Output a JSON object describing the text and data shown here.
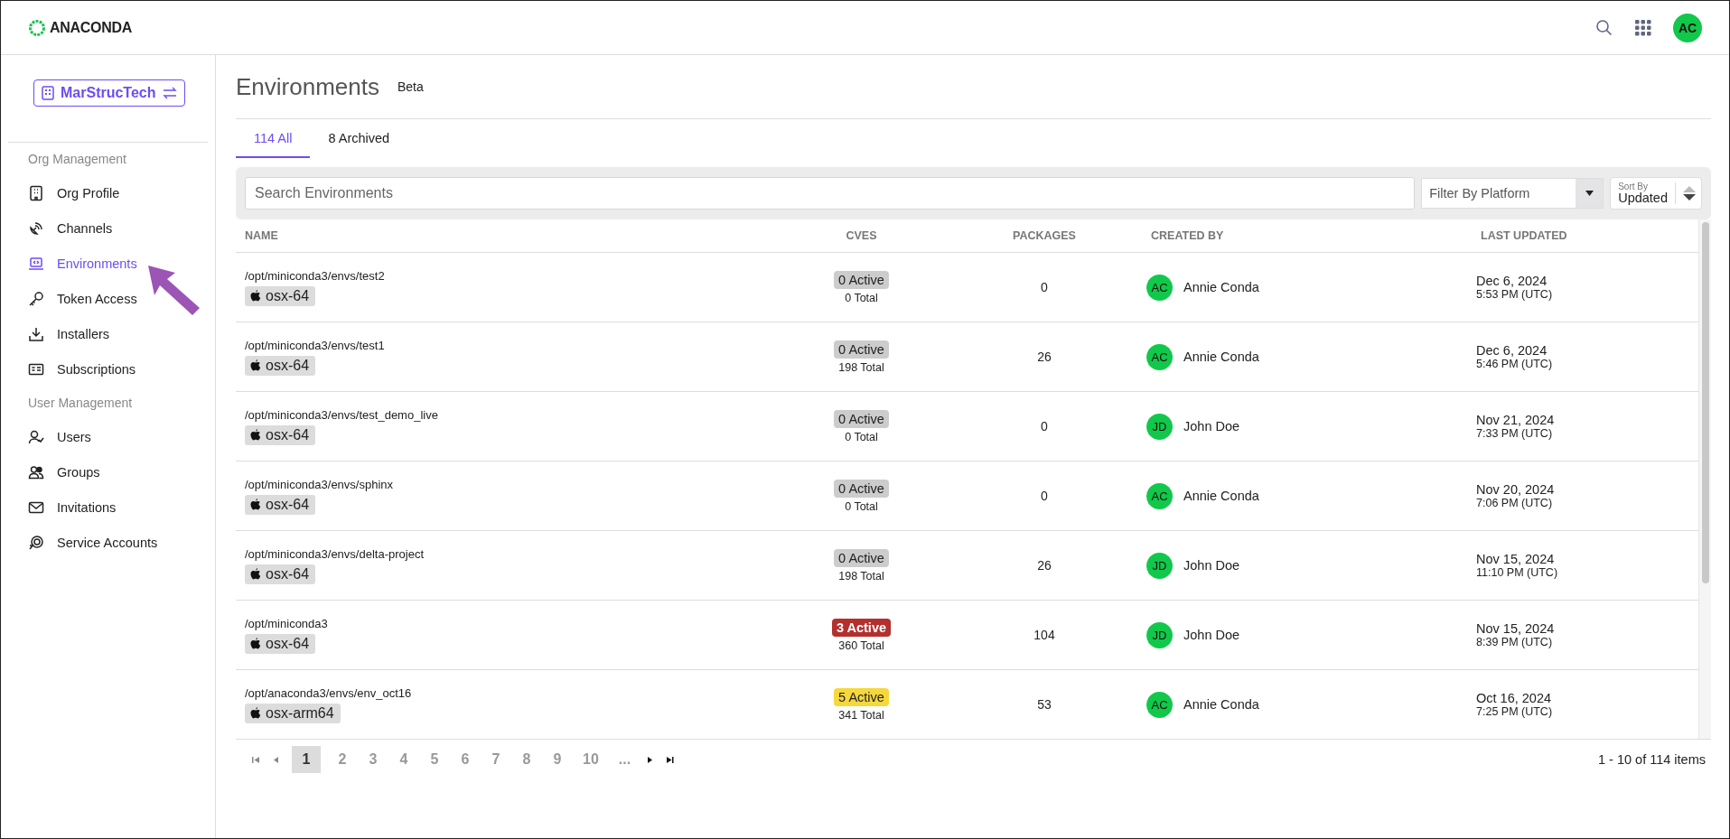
{
  "header": {
    "logo": "ANACONDA",
    "avatar": "AC"
  },
  "sidebar": {
    "org_button": "MarStrucTech",
    "sections": [
      {
        "title": "Org Management",
        "items": [
          {
            "label": "Org Profile",
            "selected": false
          },
          {
            "label": "Channels",
            "selected": false
          },
          {
            "label": "Environments",
            "selected": true
          },
          {
            "label": "Token Access",
            "selected": false
          },
          {
            "label": "Installers",
            "selected": false
          },
          {
            "label": "Subscriptions",
            "selected": false
          }
        ]
      },
      {
        "title": "User Management",
        "items": [
          {
            "label": "Users",
            "selected": false
          },
          {
            "label": "Groups",
            "selected": false
          },
          {
            "label": "Invitations",
            "selected": false
          },
          {
            "label": "Service Accounts",
            "selected": false
          }
        ]
      }
    ]
  },
  "page": {
    "title": "Environments",
    "badge": "Beta"
  },
  "tabs": [
    {
      "count": "114",
      "label": "All",
      "selected": true
    },
    {
      "count": "8",
      "label": "Archived",
      "selected": false
    }
  ],
  "search": {
    "placeholder": "Search Environments"
  },
  "filter": {
    "placeholder": "Filter By Platform"
  },
  "sort": {
    "label": "Sort By",
    "value": "Updated"
  },
  "table": {
    "columns": [
      "NAME",
      "CVES",
      "PACKAGES",
      "CREATED BY",
      "LAST UPDATED"
    ],
    "rows": [
      {
        "path": "/opt/miniconda3/envs/test2",
        "platform": "osx-64",
        "active": "0 Active",
        "color": "#cccccc",
        "total": "0 Total",
        "packages": "0",
        "initials": "AC",
        "user": "Annie Conda",
        "date": "Dec 6, 2024",
        "time": "5:53 PM (UTC)"
      },
      {
        "path": "/opt/miniconda3/envs/test1",
        "platform": "osx-64",
        "active": "0 Active",
        "color": "#cccccc",
        "total": "198 Total",
        "packages": "26",
        "initials": "AC",
        "user": "Annie Conda",
        "date": "Dec 6, 2024",
        "time": "5:46 PM (UTC)"
      },
      {
        "path": "/opt/miniconda3/envs/test_demo_live",
        "platform": "osx-64",
        "active": "0 Active",
        "color": "#cccccc",
        "total": "0 Total",
        "packages": "0",
        "initials": "JD",
        "user": "John Doe",
        "date": "Nov 21, 2024",
        "time": "7:33 PM (UTC)"
      },
      {
        "path": "/opt/miniconda3/envs/sphinx",
        "platform": "osx-64",
        "active": "0 Active",
        "color": "#cccccc",
        "total": "0 Total",
        "packages": "0",
        "initials": "AC",
        "user": "Annie Conda",
        "date": "Nov 20, 2024",
        "time": "7:06 PM (UTC)"
      },
      {
        "path": "/opt/miniconda3/envs/delta-project",
        "platform": "osx-64",
        "active": "0 Active",
        "color": "#cccccc",
        "total": "198 Total",
        "packages": "26",
        "initials": "JD",
        "user": "John Doe",
        "date": "Nov 15, 2024",
        "time": "11:10 PM (UTC)"
      },
      {
        "path": "/opt/miniconda3",
        "platform": "osx-64",
        "active": "3 Active",
        "color": "#b3302d",
        "total": "360 Total",
        "packages": "104",
        "initials": "JD",
        "user": "John Doe",
        "date": "Nov 15, 2024",
        "time": "8:39 PM (UTC)"
      },
      {
        "path": "/opt/anaconda3/envs/env_oct16",
        "platform": "osx-arm64",
        "active": "5 Active",
        "color": "#f6d83c",
        "total": "341 Total",
        "packages": "53",
        "initials": "AC",
        "user": "Annie Conda",
        "date": "Oct 16, 2024",
        "time": "7:25 PM (UTC)"
      }
    ]
  },
  "pagination": {
    "pages": [
      {
        "label": "1",
        "selected": true
      },
      {
        "label": "2",
        "selected": false
      },
      {
        "label": "3",
        "selected": false
      },
      {
        "label": "4",
        "selected": false
      },
      {
        "label": "5",
        "selected": false
      },
      {
        "label": "6",
        "selected": false
      },
      {
        "label": "7",
        "selected": false
      },
      {
        "label": "8",
        "selected": false
      },
      {
        "label": "9",
        "selected": false
      },
      {
        "label": "10",
        "selected": false
      },
      {
        "label": "...",
        "selected": false
      }
    ],
    "summary": "1 - 10 of 114 items"
  }
}
